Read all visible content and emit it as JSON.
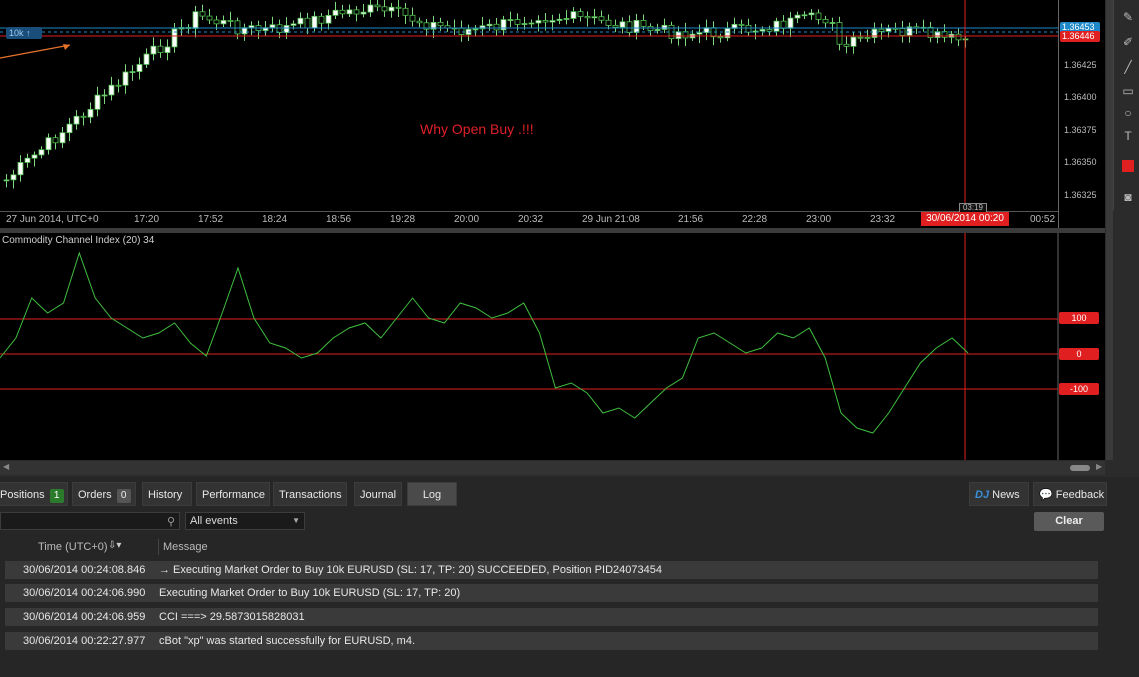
{
  "price_chart": {
    "price_labels": [
      "1.36425",
      "1.36400",
      "1.36375",
      "1.36350",
      "1.36325"
    ],
    "current_price": "1.36446",
    "ask_price": "1.36453",
    "volume_tag": "10k ↑",
    "annotation": "Why Open Buy .!!!",
    "time_labels": [
      "27 Jun 2014, UTC+0",
      "17:20",
      "17:52",
      "18:24",
      "18:56",
      "19:28",
      "20:00",
      "20:32",
      "29 Jun 21:08",
      "21:56",
      "22:28",
      "23:00",
      "23:32",
      "00:52"
    ],
    "cursor_time": "30/06/2014 00:20",
    "cursor_small_label": "03:19",
    "colors": {
      "bull": "#ffffff",
      "bear": "#000000",
      "wick": "#7fd87f",
      "outline": "#4fbf4f",
      "line_red": "#e02020",
      "line_blue": "#1e88c8"
    }
  },
  "cci": {
    "title": "Commodity Channel Index (20) 34",
    "levels": [
      "100",
      "0",
      "-100"
    ],
    "line_color": "#3fbf3f"
  },
  "toolbar": {
    "icons": [
      "pencil-icon",
      "pencil-icon",
      "line-icon",
      "rectangle-icon",
      "circle-icon",
      "text-icon",
      "color-swatch-icon",
      "camera-icon"
    ]
  },
  "bottom": {
    "tabs": [
      {
        "label": "Positions",
        "count": "1"
      },
      {
        "label": "Orders",
        "count": "0"
      },
      {
        "label": "History"
      },
      {
        "label": "Performance"
      },
      {
        "label": "Transactions"
      },
      {
        "label": "Journal"
      },
      {
        "label": "Log"
      }
    ],
    "news_label": "News",
    "news_prefix": "DJ",
    "feedback_label": "Feedback",
    "events_select": "All events",
    "clear_label": "Clear",
    "search_placeholder": "",
    "log_header_time": "Time (UTC+0)",
    "log_header_msg": "Message",
    "log_rows": [
      {
        "time": "30/06/2014 00:24:08.846",
        "message": "→ Executing Market Order to Buy 10k EURUSD (SL: 17, TP: 20) SUCCEEDED, Position PID24073454"
      },
      {
        "time": "30/06/2014 00:24:06.990",
        "message": "Executing Market Order to Buy 10k EURUSD (SL: 17, TP: 20)"
      },
      {
        "time": "30/06/2014 00:24:06.959",
        "message": "CCI ===> 29.5873015828031"
      },
      {
        "time": "30/06/2014 00:22:27.977",
        "message": "cBot \"xp\" was started successfully for EURUSD, m4."
      }
    ]
  }
}
